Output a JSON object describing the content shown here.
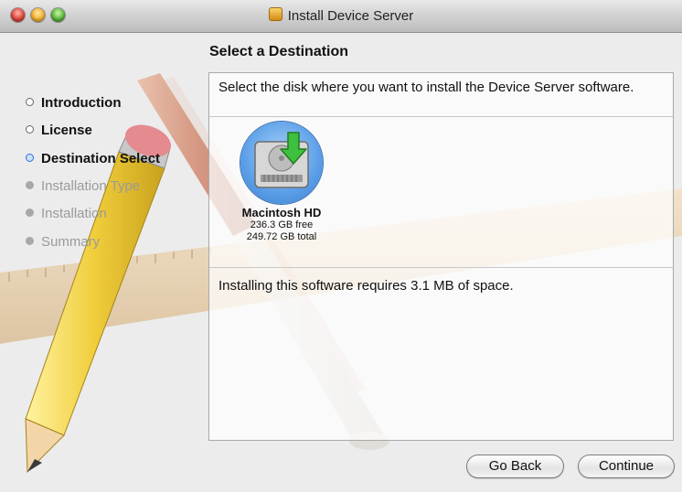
{
  "window": {
    "title": "Install Device Server"
  },
  "sidebar": {
    "steps": [
      {
        "label": "Introduction",
        "state": "done"
      },
      {
        "label": "License",
        "state": "done"
      },
      {
        "label": "Destination Select",
        "state": "current"
      },
      {
        "label": "Installation Type",
        "state": "todo"
      },
      {
        "label": "Installation",
        "state": "todo"
      },
      {
        "label": "Summary",
        "state": "todo"
      }
    ]
  },
  "main": {
    "heading": "Select a Destination",
    "prompt": "Select the disk where you want to install the Device Server software.",
    "disk": {
      "name": "Macintosh HD",
      "free": "236.3 GB free",
      "total": "249.72 GB total"
    },
    "requirement": "Installing this software requires 3.1 MB of space."
  },
  "buttons": {
    "back": "Go Back",
    "continue": "Continue"
  },
  "colors": {
    "current_step_bullet": "#2b6fd6",
    "disk_selection": "#5a9ee8"
  }
}
